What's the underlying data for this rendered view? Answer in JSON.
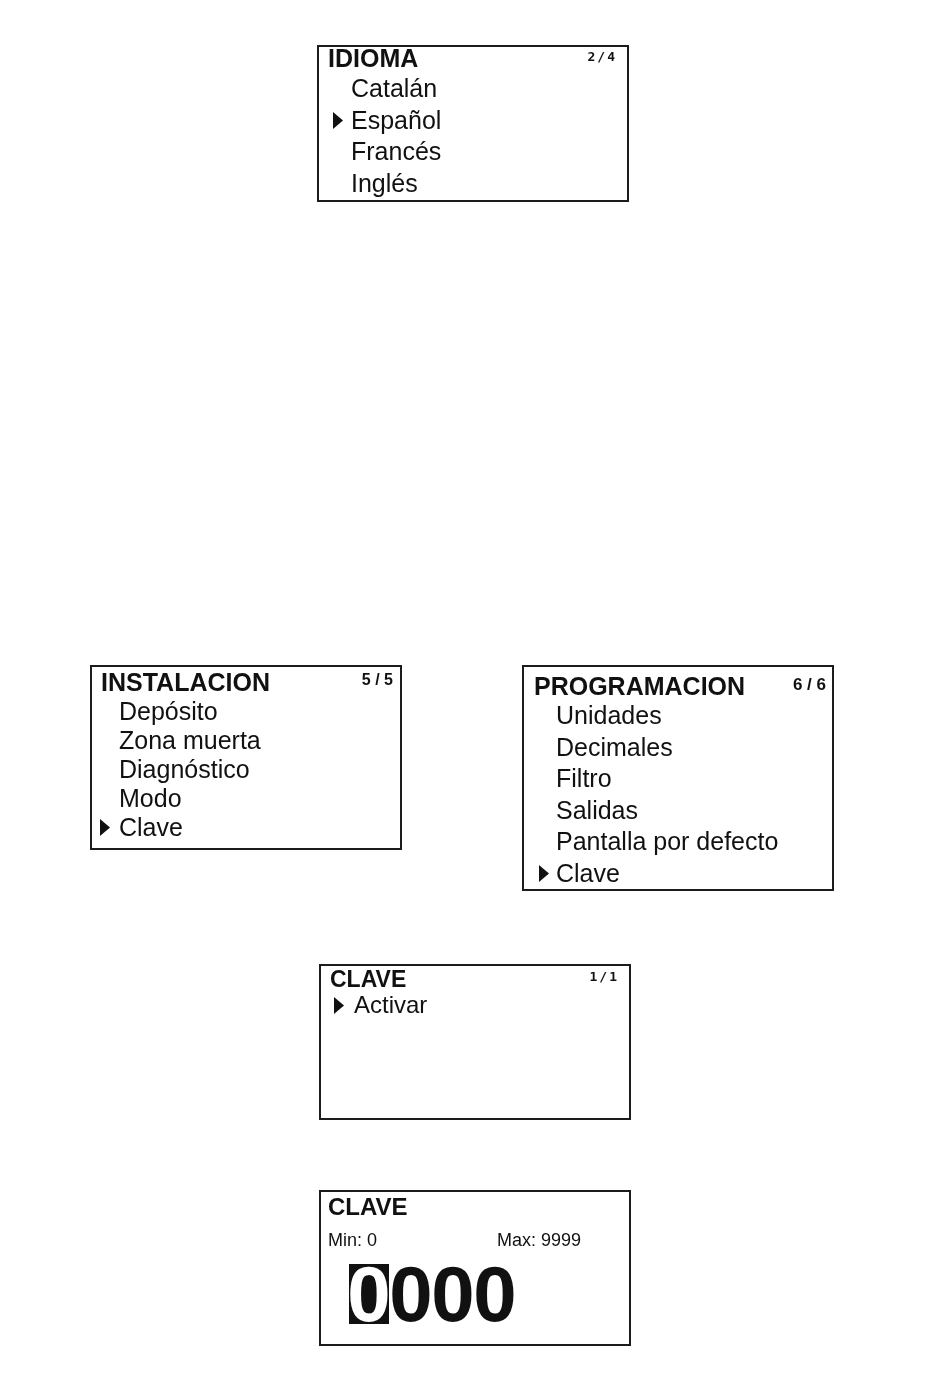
{
  "screens": [
    {
      "kind": "menu",
      "title": "IDIOMA",
      "page": "2/4",
      "items": [
        {
          "label": "Catalán",
          "selected": false
        },
        {
          "label": "Español",
          "selected": true
        },
        {
          "label": "Francés",
          "selected": false
        },
        {
          "label": "Inglés",
          "selected": false
        }
      ]
    },
    {
      "kind": "menu",
      "title": "INSTALACION",
      "page": "5 / 5",
      "items": [
        {
          "label": "Depósito",
          "selected": false
        },
        {
          "label": "Zona muerta",
          "selected": false
        },
        {
          "label": "Diagnóstico",
          "selected": false
        },
        {
          "label": "Modo",
          "selected": false
        },
        {
          "label": "Clave",
          "selected": true
        }
      ]
    },
    {
      "kind": "menu",
      "title": "PROGRAMACION",
      "page": "6 / 6",
      "items": [
        {
          "label": "Unidades",
          "selected": false
        },
        {
          "label": "Decimales",
          "selected": false
        },
        {
          "label": "Filtro",
          "selected": false
        },
        {
          "label": "Salidas",
          "selected": false
        },
        {
          "label": "Pantalla por defecto",
          "selected": false
        },
        {
          "label": "Clave",
          "selected": true
        }
      ]
    },
    {
      "kind": "menu",
      "title": "CLAVE",
      "page": "1/1",
      "items": [
        {
          "label": "Activar",
          "selected": true
        }
      ]
    },
    {
      "kind": "entry",
      "title": "CLAVE",
      "min": "Min: 0",
      "max": "Max: 9999",
      "digits": [
        {
          "value": "0",
          "selected": true
        },
        {
          "value": "0",
          "selected": false
        },
        {
          "value": "0",
          "selected": false
        },
        {
          "value": "0",
          "selected": false
        }
      ]
    }
  ]
}
